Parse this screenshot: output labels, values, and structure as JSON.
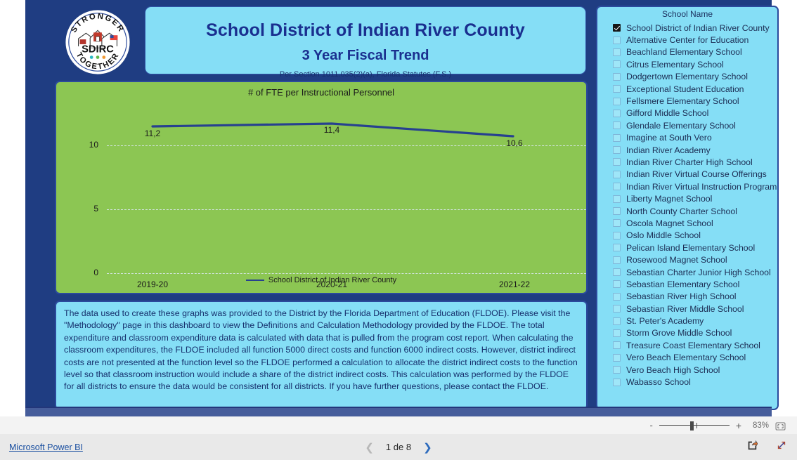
{
  "header": {
    "logo": {
      "name": "sdirc-logo",
      "arc_top": "STRONGER",
      "arc_bottom": "TOGETHER",
      "center_text": "SDIRC",
      "dot_colors": [
        "#2BB8C4",
        "#5FB94A",
        "#F29A33"
      ]
    },
    "title_main": "School District of Indian River County",
    "title_sub": "3 Year Fiscal Trend",
    "citation": "Per Section 1011.035(2)(a), Florida Statutes (F.S.)"
  },
  "chart_data": {
    "type": "line",
    "title": "# of FTE per Instructional Personnel",
    "categories": [
      "2019-20",
      "2020-21",
      "2021-22"
    ],
    "series": [
      {
        "name": "School District of Indian River County",
        "values": [
          11.2,
          11.4,
          10.6
        ],
        "labels": [
          "11,2",
          "11,4",
          "10,6"
        ],
        "color": "#27418F"
      }
    ],
    "yticks": [
      "10",
      "5",
      "0"
    ],
    "ytick_values": [
      10,
      5,
      0
    ],
    "ylim": [
      0,
      12.5
    ],
    "xlabel": "",
    "ylabel": "",
    "grid": true,
    "legend_position": "bottom",
    "plot_background": "#8CC653"
  },
  "note": {
    "text": "The data used to create these graphs was provided to the District by the Florida Department of Education (FLDOE). Please visit the \"Methodology\" page in this dashboard to view the Definitions and Calculation Methodology provided by the FLDOE. The total expenditure and classroom expenditure data is calculated with data that is pulled from the program cost report. When calculating the classroom expenditures, the FLDOE included all function 5000 direct costs and function 6000 indirect costs. However, district indirect costs are not presented at the function level so the FLDOE performed a calculation to allocate the district indirect costs to the function level so that classroom instruction would include a share of the district indirect costs. This calculation was performed by the FLDOE for all districts to ensure the data would be consistent for all districts. If you have further questions, please contact the FLDOE."
  },
  "slicer": {
    "header": "School Name",
    "items": [
      {
        "label": "School District of Indian River County",
        "checked": true
      },
      {
        "label": "Alternative Center for Education",
        "checked": false
      },
      {
        "label": "Beachland Elementary School",
        "checked": false
      },
      {
        "label": "Citrus Elementary School",
        "checked": false
      },
      {
        "label": "Dodgertown Elementary School",
        "checked": false
      },
      {
        "label": "Exceptional Student Education",
        "checked": false
      },
      {
        "label": "Fellsmere Elementary School",
        "checked": false
      },
      {
        "label": "Gifford Middle School",
        "checked": false
      },
      {
        "label": "Glendale Elementary School",
        "checked": false
      },
      {
        "label": "Imagine at South Vero",
        "checked": false
      },
      {
        "label": "Indian River Academy",
        "checked": false
      },
      {
        "label": "Indian River Charter High School",
        "checked": false
      },
      {
        "label": "Indian River Virtual Course Offerings",
        "checked": false
      },
      {
        "label": "Indian River Virtual Instruction Program",
        "checked": false
      },
      {
        "label": "Liberty Magnet School",
        "checked": false
      },
      {
        "label": "North County Charter School",
        "checked": false
      },
      {
        "label": "Oscola Magnet School",
        "checked": false
      },
      {
        "label": "Oslo Middle School",
        "checked": false
      },
      {
        "label": "Pelican Island Elementary School",
        "checked": false
      },
      {
        "label": "Rosewood Magnet School",
        "checked": false
      },
      {
        "label": "Sebastian Charter Junior High School",
        "checked": false
      },
      {
        "label": "Sebastian Elementary School",
        "checked": false
      },
      {
        "label": "Sebastian River High School",
        "checked": false
      },
      {
        "label": "Sebastian River Middle School",
        "checked": false
      },
      {
        "label": "St. Peter's Academy",
        "checked": false
      },
      {
        "label": "Storm Grove Middle School",
        "checked": false
      },
      {
        "label": "Treasure Coast Elementary School",
        "checked": false
      },
      {
        "label": "Vero Beach Elementary School",
        "checked": false
      },
      {
        "label": "Vero Beach High School",
        "checked": false
      },
      {
        "label": "Wabasso School",
        "checked": false
      }
    ]
  },
  "zoombar": {
    "minus_label": "-",
    "plus_label": "+",
    "percent": "83%",
    "fit_icon": "fit-to-page-icon"
  },
  "footer": {
    "brand": "Microsoft Power BI",
    "prev_icon": "chevron-left-icon",
    "next_icon": "chevron-right-icon",
    "page_label": "1 de 8",
    "share_icon": "share-icon",
    "fullscreen_icon": "fullscreen-icon"
  },
  "colors": {
    "canvas_navy": "#1F3D82",
    "panel_blue": "#85DEF6",
    "chart_green": "#8CC653",
    "line_navy": "#27418F",
    "title_text": "#1a2f8f"
  }
}
